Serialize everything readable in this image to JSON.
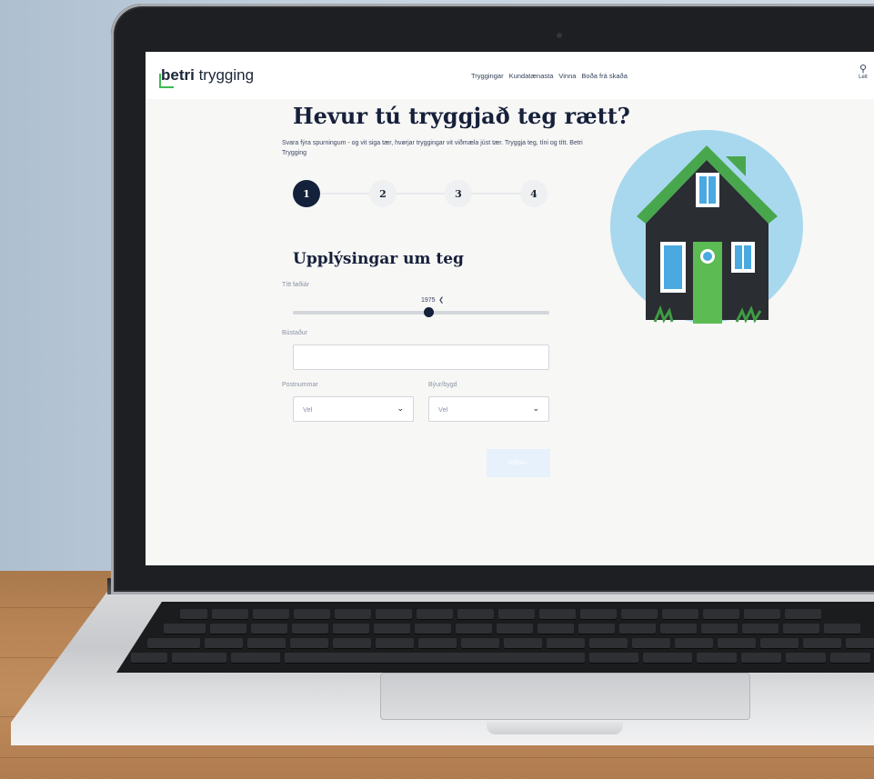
{
  "site": {
    "logo_bold": "betri",
    "logo_rest": " trygging",
    "nav": [
      "Tryggingar",
      "Kundatænasta",
      "Vinna",
      "Boða frá skaða"
    ],
    "search_label": "Leit"
  },
  "page": {
    "title": "Hevur tú tryggjað teg rætt?",
    "intro": "Svara fýra spurningum - og vit siga tær, hvørjar tryggingar vit viðmæla júst tær. Tryggja teg, tíni og títt. Betri Trygging",
    "steps": [
      "1",
      "2",
      "3",
      "4"
    ],
    "active_step": 1,
    "section_title": "Upplýsingar um teg",
    "birth_year_label": "Títt føðiár",
    "birth_year_value": "1975",
    "birth_year_edit_icon": "pencil-icon",
    "address_label": "Bústaður",
    "address_value": "",
    "postcode_label": "Postnummar",
    "postcode_value": "Vel",
    "city_label": "Býur/bygd",
    "city_value": "Vel",
    "next_button": "Víðari  ›"
  },
  "colors": {
    "navy": "#14213b",
    "brand_green": "#3dbb55",
    "button_disabled": "#e6f1fb"
  }
}
